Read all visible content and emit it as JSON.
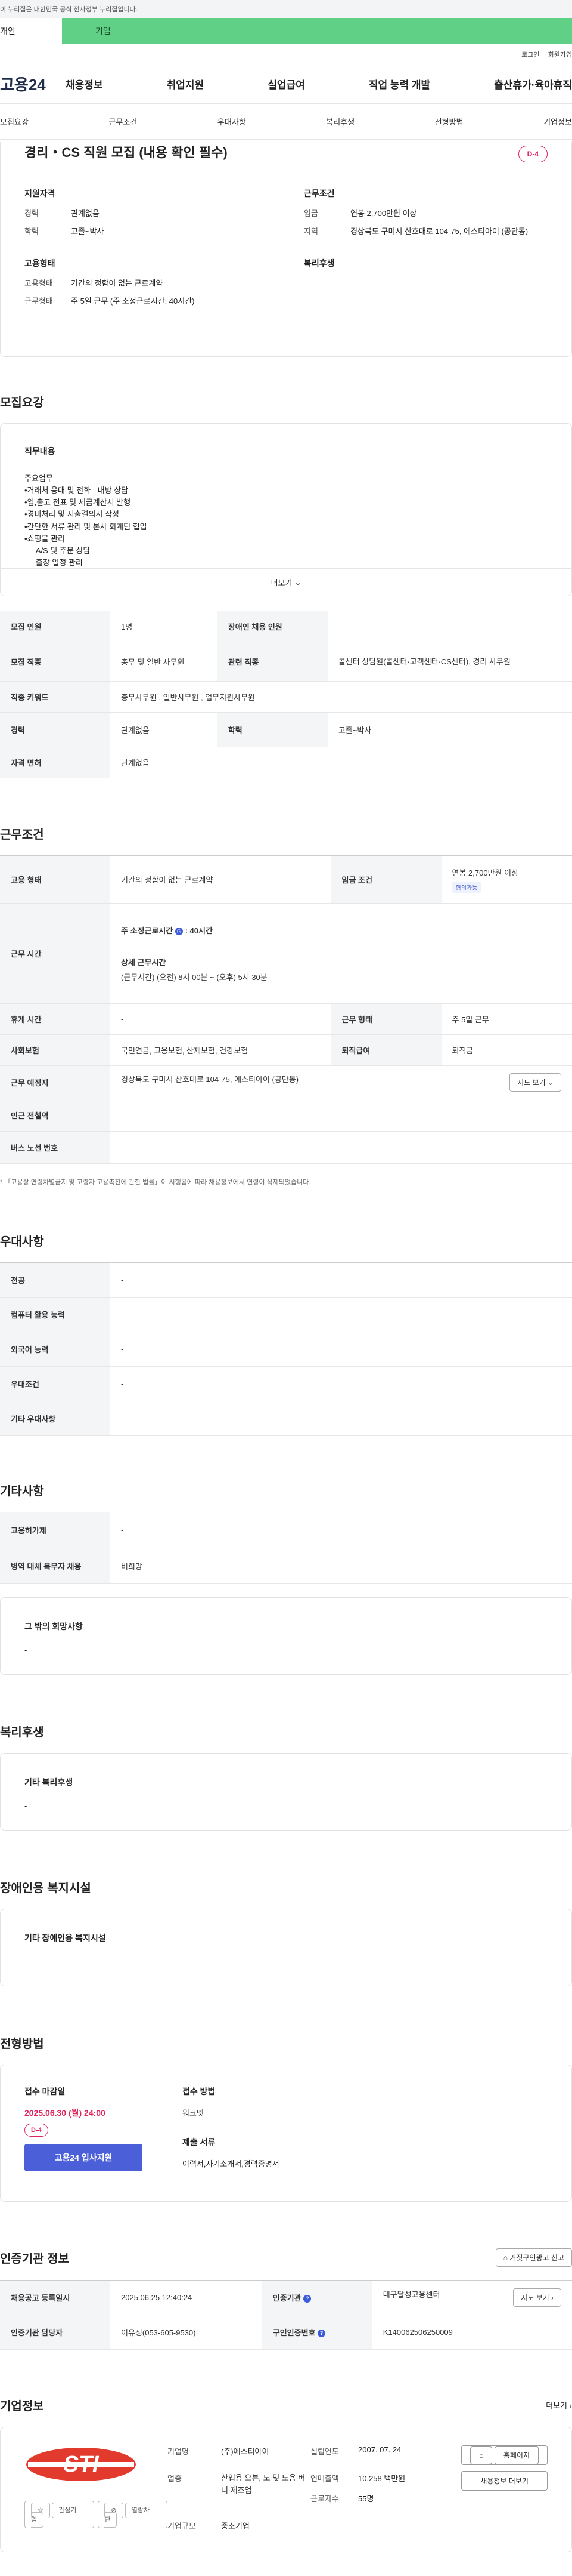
{
  "banner": "이 누리집은 대한민국 공식 전자정부 누리집입니다.",
  "type_tabs": [
    "개인",
    "기업"
  ],
  "util": [
    "로그인",
    "회원가입"
  ],
  "gnb": {
    "logo": "고용24",
    "menu": [
      "채용정보",
      "취업지원",
      "실업급여",
      "직업 능력 개발",
      "출산휴가·육아휴직"
    ]
  },
  "subnav": [
    "모집요강",
    "근무조건",
    "우대사항",
    "복리후생",
    "전형방법",
    "기업정보"
  ],
  "summary": {
    "title": "경리・CS 직원 모집 (내용 확인 필수)",
    "dday": "D-4",
    "qual_h": "지원자격",
    "qual": [
      {
        "k": "경력",
        "v": "관계없음"
      },
      {
        "k": "학력",
        "v": "고졸~박사"
      }
    ],
    "work_h": "근무조건",
    "work": [
      {
        "k": "임금",
        "v": "연봉 2,700만원 이상"
      },
      {
        "k": "지역",
        "v": "경상북도 구미시 산호대로 104-75, 에스티아이 (공단동)"
      }
    ],
    "type_h": "고용형태",
    "type": [
      {
        "k": "고용형태",
        "v": "기간의 정함이 없는 근로계약"
      },
      {
        "k": "근무형태",
        "v": "주 5일 근무 (주 소정근로시간: 40시간)"
      }
    ],
    "welfare_h": "복리후생"
  },
  "recruit": {
    "section_title": "모집요강",
    "duty_h": "직무내용",
    "duty_text": "주요업무\n•거래처 응대 및 전화 - 내방 상담\n•입,출고 전표 및 세금계산서 발행\n•경비처리 및 지출결의서 작성\n•간단한 서류 관리 및 본사 회계팀 협업\n•쇼핑몰 관리\n   - A/S 및 주문 상담\n   - 출장 일정 관리\n   - 택배 업무",
    "more": "더보기",
    "rows": [
      [
        {
          "k": "모집 인원",
          "v": "1명"
        },
        {
          "k": "장애인 채용 인원",
          "v": "-"
        }
      ],
      [
        {
          "k": "모집 직종",
          "v": "총무 및 일반 사무원"
        },
        {
          "k": "관련 직종",
          "v": "콜센터 상담원(콜센터·고객센터·CS센터), 경리 사무원"
        }
      ],
      [
        {
          "k": "직종 키워드",
          "v": "총무사무원 , 일반사무원 , 업무지원사무원"
        }
      ],
      [
        {
          "k": "경력",
          "v": "관계없음"
        },
        {
          "k": "학력",
          "v": "고졸~박사"
        }
      ],
      [
        {
          "k": "자격 면허",
          "v": "관계없음"
        }
      ]
    ]
  },
  "work": {
    "section_title": "근무조건",
    "emp_type_k": "고용 형태",
    "emp_type_v": "기간의 정함이 없는 근로계약",
    "wage_k": "임금 조건",
    "wage_v": "연봉 2,700만원 이상",
    "wage_tag": "협의가능",
    "hours_k": "근무 시간",
    "hours_weekly": "주 소정근로시간",
    "hours_weekly_v": ": 40시간",
    "hours_detail_h": "상세 근무시간",
    "hours_detail": "(근무시간) (오전) 8시 00분 ~ (오후) 5시 30분",
    "break_k": "휴게 시간",
    "break_v": "-",
    "shift_k": "근무 형태",
    "shift_v": "주 5일 근무",
    "ins_k": "사회보험",
    "ins_v": "국민연금, 고용보험, 산재보험, 건강보험",
    "retire_k": "퇴직급여",
    "retire_v": "퇴직금",
    "place_k": "근무 예정지",
    "place_v": "경상북도 구미시 산호대로 104-75, 에스티아이 (공단동)",
    "map_btn": "지도 보기",
    "subway_k": "인근 전철역",
    "subway_v": "-",
    "bus_k": "버스 노선 번호",
    "bus_v": "-",
    "note": "* 「고용상 연령차별금지 및 고령자 고용촉진에 관한 법률」이 시행됨에 따라 채용정보에서 연령이 삭제되었습니다."
  },
  "pref": {
    "section_title": "우대사항",
    "rows": [
      {
        "k": "전공",
        "v": "-"
      },
      {
        "k": "컴퓨터 활용 능력",
        "v": "-"
      },
      {
        "k": "외국어 능력",
        "v": "-"
      },
      {
        "k": "우대조건",
        "v": "-"
      },
      {
        "k": "기타 우대사항",
        "v": "-"
      }
    ]
  },
  "etc": {
    "section_title": "기타사항",
    "rows": [
      {
        "k": "고용허가제",
        "v": "-"
      },
      {
        "k": "병역 대체 복무자 채용",
        "v": "비희망"
      }
    ],
    "wish_h": "그 밖의 희망사항",
    "wish_v": "-"
  },
  "welfare": {
    "section_title": "복리후생",
    "h": "기타 복리후생",
    "v": "-"
  },
  "disabled": {
    "section_title": "장애인용 복지시설",
    "h": "기타 장애인용 복지시설",
    "v": "-"
  },
  "process": {
    "section_title": "전형방법",
    "deadline_h": "접수 마감일",
    "deadline": "2025.06.30 (월) 24:00",
    "dday": "D-4",
    "apply": "고용24 입사지원",
    "method_h": "접수 방법",
    "method_v": "워크넷",
    "docs_h": "제출 서류",
    "docs_v": "이력서,자기소개서,경력증명서"
  },
  "cert": {
    "section_title": "인증기관 정보",
    "report_btn": "거짓구인광고 신고",
    "r1k": "채용공고 등록일시",
    "r1v": "2025.06.25 12:40:24",
    "r2k": "인증기관",
    "r2v": "대구달성고용센터",
    "map_btn": "지도 보기",
    "r3k": "인증기관 담당자",
    "r3v": "이유정(053-605-9530)",
    "r4k": "구인인증번호",
    "r4v": "K140062506250009"
  },
  "company": {
    "section_title": "기업정보",
    "more": "더보기",
    "logo_text": "STI",
    "fav": "관심기업",
    "block": "열람차단",
    "items": [
      {
        "k": "기업명",
        "v": "(주)에스티아이"
      },
      {
        "k": "설립연도",
        "v": "2007. 07. 24"
      },
      {
        "k": "업종",
        "v": "산업용 오븐, 노 및 노용 버너 제조업"
      },
      {
        "k": "연매출액",
        "v": "10,258 백만원"
      },
      {
        "k": "근로자수",
        "v": "55명"
      },
      {
        "k": "기업규모",
        "v": "중소기업"
      }
    ],
    "homepage": "홈페이지",
    "jobs": "채용정보 더보기"
  },
  "colors": {
    "accent": "#4b5fd8",
    "dday": "#e0245e",
    "tab_green": "#5fd086"
  }
}
